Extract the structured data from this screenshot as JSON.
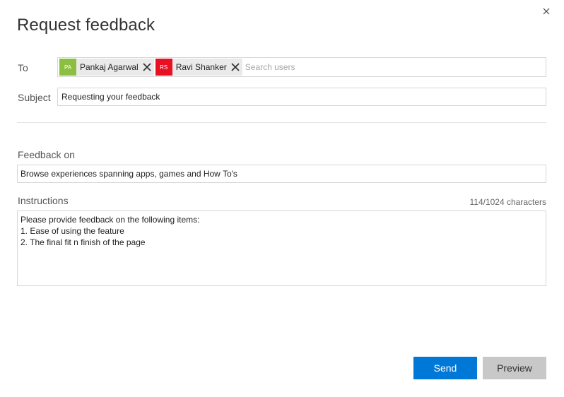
{
  "dialog": {
    "title": "Request feedback",
    "close_icon": "close-icon"
  },
  "to": {
    "label": "To",
    "recipients": [
      {
        "initials": "PA",
        "name": "Pankaj Agarwal",
        "color": "#8cbf3f"
      },
      {
        "initials": "RS",
        "name": "Ravi Shanker",
        "color": "#e81123"
      }
    ],
    "remove_icon": "close-icon",
    "search_placeholder": "Search users"
  },
  "subject": {
    "label": "Subject",
    "value": "Requesting your feedback"
  },
  "feedback_on": {
    "label": "Feedback on",
    "value": "Browse experiences spanning apps, games and How To's"
  },
  "instructions": {
    "label": "Instructions",
    "char_count": "114/1024 characters",
    "lines": [
      "Please provide feedback on the following items:",
      "1. Ease of using the feature",
      "2. The final fit n finish of the page"
    ]
  },
  "actions": {
    "send_label": "Send",
    "preview_label": "Preview"
  },
  "colors": {
    "accent": "#0078d7",
    "secondary_button": "#c8c8c8"
  }
}
